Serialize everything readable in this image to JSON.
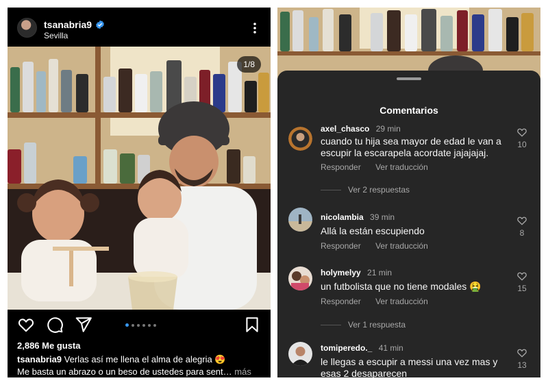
{
  "left_post": {
    "username": "tsanabria9",
    "location": "Sevilla",
    "image_counter": "1/8",
    "likes": "2,886 Me gusta",
    "caption_user": "tsanabria9",
    "caption_line1": "Verlas así me llena el alma de alegria 😍",
    "caption_line2": "Me basta un abrazo o un beso de ustedes para sent…",
    "more_label": "más",
    "carousel": {
      "total": 6,
      "active_index": 0
    },
    "icons": [
      "heart-icon",
      "comment-icon",
      "share-icon",
      "bookmark-icon",
      "more-options-icon",
      "verified-badge-icon"
    ]
  },
  "comments_sheet": {
    "title": "Comentarios",
    "reply_label": "Responder",
    "translate_label": "Ver traducción",
    "comments": [
      {
        "user": "axel_chasco",
        "time": "29 min",
        "text": "cuando tu hija sea mayor de edad le van a escupir la escarapela acordate jajajajaj.",
        "likes": "10",
        "replies": "Ver 2 respuestas"
      },
      {
        "user": "nicolambia",
        "time": "39 min",
        "text": "Allá la están escupiendo",
        "likes": "8",
        "replies": ""
      },
      {
        "user": "holymelyy",
        "time": "21 min",
        "text": "un futbolista que no tiene modales 🤮",
        "likes": "15",
        "replies": "Ver 1 respuesta"
      },
      {
        "user": "tomiperedo._",
        "time": "41 min",
        "text": "le llegas a escupir a messi una vez mas y esas 2 desaparecen",
        "likes": "13",
        "replies": ""
      }
    ]
  },
  "colors": {
    "background": "#000000",
    "sheet": "#262626",
    "accent_blue": "#3897f0",
    "muted_text": "#a8a8a8"
  }
}
